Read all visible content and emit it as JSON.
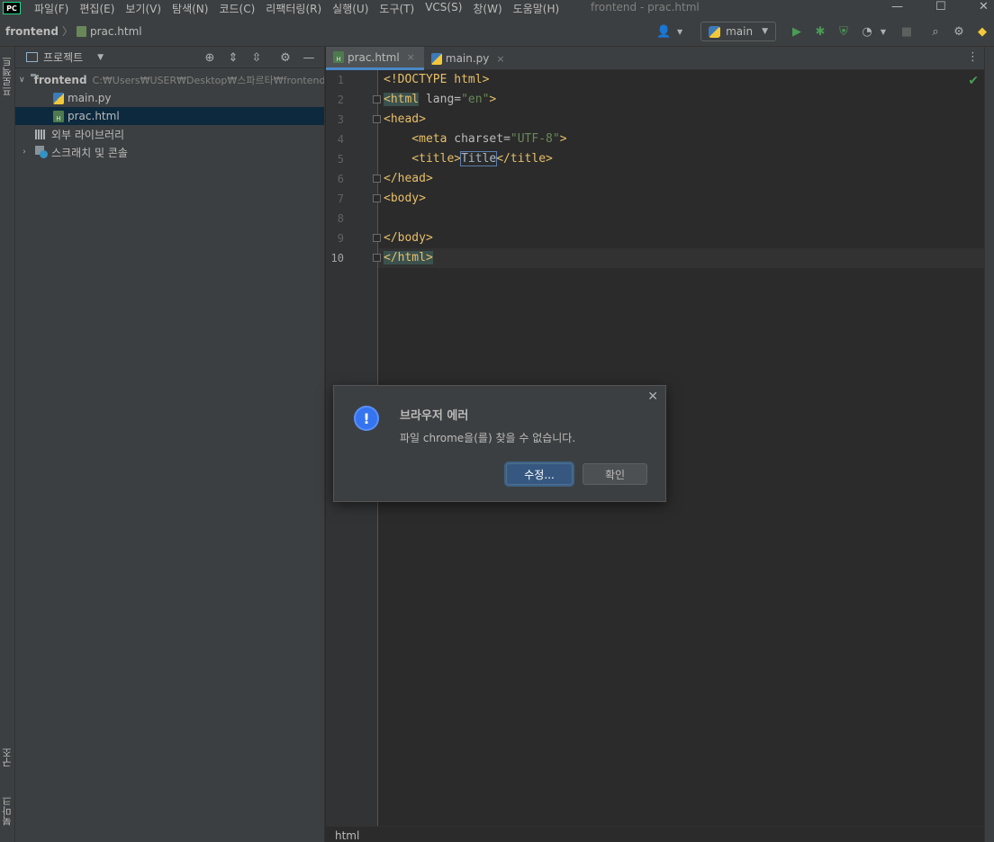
{
  "app": {
    "logo_text": "PC",
    "window_title": "frontend - prac.html"
  },
  "menu": [
    "파일(F)",
    "편집(E)",
    "보기(V)",
    "탐색(N)",
    "코드(C)",
    "리팩터링(R)",
    "실행(U)",
    "도구(T)",
    "VCS(S)",
    "창(W)",
    "도움말(H)"
  ],
  "navbar": {
    "root": "frontend",
    "file": "prac.html",
    "run_config": "main"
  },
  "left_strip": {
    "project_tab": "프로젝트",
    "structure_tab": "구조",
    "bookmarks_tab": "북마크"
  },
  "project_panel": {
    "title": "프로젝트",
    "tree": {
      "root_name": "frontend",
      "root_path": "C:₩Users₩USER₩Desktop₩스파르타₩frontend",
      "file1": "main.py",
      "file2": "prac.html",
      "libs": "외부 라이브러리",
      "scratch": "스크래치 및 콘솔"
    }
  },
  "editor": {
    "tabs": [
      {
        "label": "prac.html",
        "close": "×"
      },
      {
        "label": "main.py",
        "close": "×"
      }
    ],
    "line_numbers": [
      "1",
      "2",
      "3",
      "4",
      "5",
      "6",
      "7",
      "8",
      "9",
      "10"
    ],
    "code": {
      "l1_tag": "<!DOCTYPE html>",
      "l2_open": "<html",
      "l2_attr": " lang=",
      "l2_val": "\"en\"",
      "l2_close": ">",
      "l3": "<head>",
      "l4_open": "    <meta",
      "l4_attr": " charset=",
      "l4_val": "\"UTF-8\"",
      "l4_close": ">",
      "l5_open": "    <title>",
      "l5_text": "Title",
      "l5_close": "</title>",
      "l6": "</head>",
      "l7": "<body>",
      "l9": "</body>",
      "l10": "</html>"
    },
    "breadcrumb": "html"
  },
  "dialog": {
    "title": "브라우저 에러",
    "message": "파일 chrome을(를) 찾을 수 없습니다.",
    "primary_button": "수정...",
    "secondary_button": "확인",
    "icon_glyph": "!"
  },
  "colors": {
    "accent": "#4a88c7",
    "tag": "#e8bf6a",
    "string": "#6a8759",
    "background": "#2b2b2b"
  }
}
